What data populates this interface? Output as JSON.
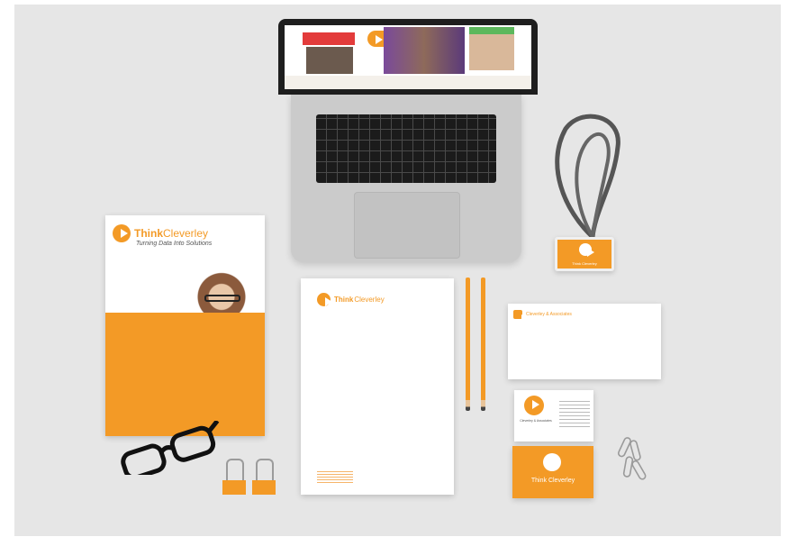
{
  "brochure": {
    "logo_think": "Think",
    "logo_cleverley": " Cleverley",
    "tagline": "Turning Data Into Solutions"
  },
  "letterhead": {
    "logo_think": "Think",
    "logo_cleverley": " Cleverley"
  },
  "envelope": {
    "text": "Cleverley & Associates"
  },
  "business_card": {
    "company": "Cleverley & Associates",
    "back_think": "Think",
    "back_cleverley": " Cleverley"
  },
  "id_badge": {
    "label": "Think Cleverley"
  },
  "colors": {
    "brand_orange": "#f39a26",
    "background": "#e6e6e6",
    "laptop_body": "#c9c9c9"
  }
}
